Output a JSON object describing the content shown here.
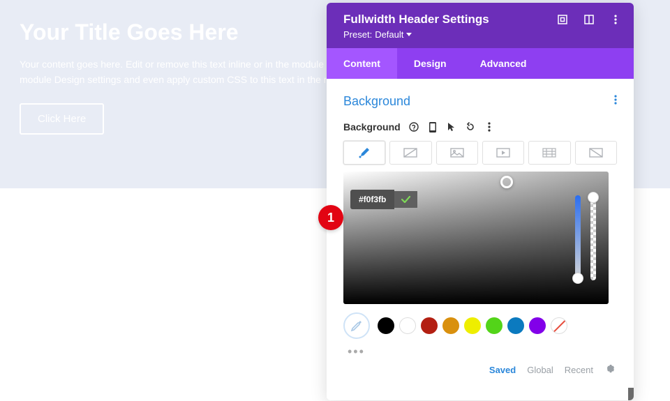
{
  "hero": {
    "title": "Your Title Goes Here",
    "text": "Your content goes here. Edit or remove this text inline or in the module Content settings. You can also style every aspect of this content in the module Design settings and even apply custom CSS to this text in the module Advanced settings.",
    "button": "Click Here"
  },
  "panel": {
    "title": "Fullwidth Header Settings",
    "preset_label": "Preset:",
    "preset_value": "Default",
    "tabs": [
      "Content",
      "Design",
      "Advanced"
    ],
    "active_tab": "Content"
  },
  "section": {
    "title": "Background",
    "field_label": "Background"
  },
  "picker": {
    "hex": "#f0f3fb"
  },
  "swatches": [
    {
      "name": "black",
      "color": "#000000"
    },
    {
      "name": "white",
      "color": "#ffffff"
    },
    {
      "name": "red",
      "color": "#b31f12"
    },
    {
      "name": "orange",
      "color": "#d9900e"
    },
    {
      "name": "yellow",
      "color": "#eeee00"
    },
    {
      "name": "green",
      "color": "#53d419"
    },
    {
      "name": "blue",
      "color": "#0b7abf"
    },
    {
      "name": "purple",
      "color": "#8200e9"
    }
  ],
  "footer": {
    "saved": "Saved",
    "global": "Global",
    "recent": "Recent"
  },
  "annotation": {
    "badge": "1"
  },
  "colors": {
    "header_bg": "#6c2eb9",
    "tabs_bg": "#8e3ff1",
    "tab_active_bg": "#a456ff",
    "accent": "#2b87da",
    "hero_bg": "#e8ecf5",
    "badge_bg": "#e20413"
  }
}
